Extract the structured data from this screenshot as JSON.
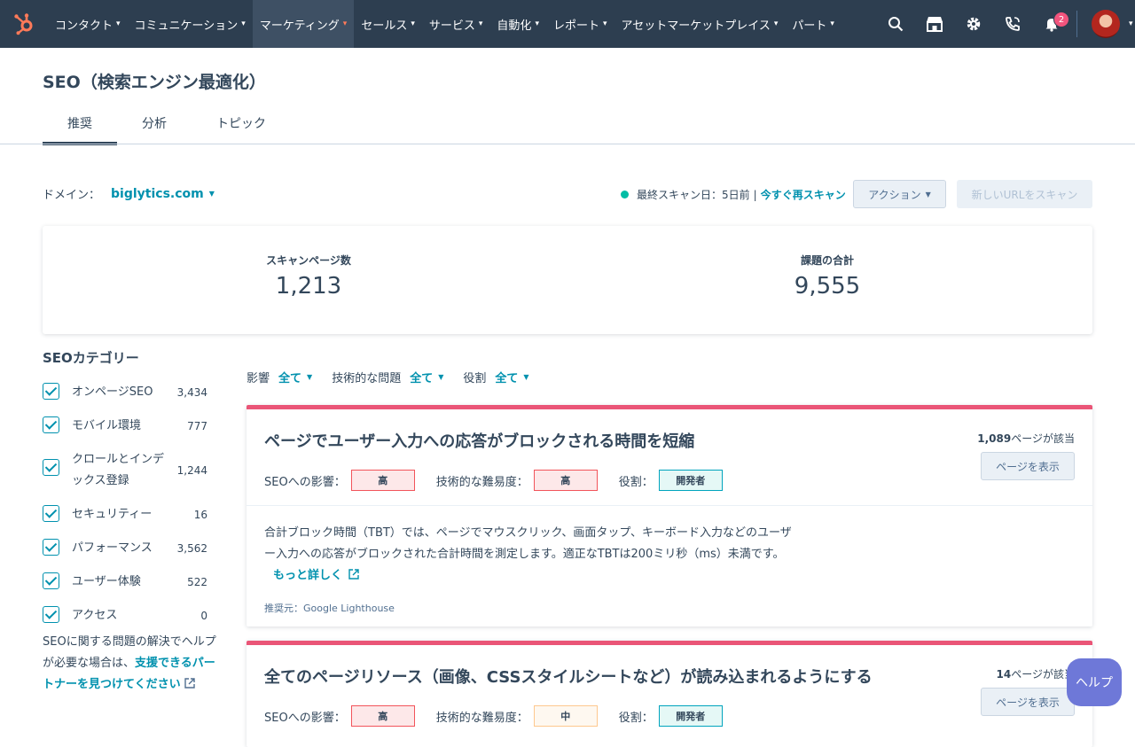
{
  "nav": {
    "items": [
      {
        "label": "コンタクト",
        "active": false
      },
      {
        "label": "コミュニケーション",
        "active": false
      },
      {
        "label": "マーケティング",
        "active": true
      },
      {
        "label": "セールス",
        "active": false
      },
      {
        "label": "サービス",
        "active": false
      },
      {
        "label": "自動化",
        "active": false
      },
      {
        "label": "レポート",
        "active": false
      },
      {
        "label": "アセットマーケットプレイス",
        "active": false
      },
      {
        "label": "パート",
        "active": false
      }
    ],
    "notification_count": "2",
    "accent_color": "#ff7a59"
  },
  "page": {
    "title": "SEO（検索エンジン最適化）",
    "tabs": [
      "推奨",
      "分析",
      "トピック"
    ]
  },
  "domain": {
    "label": "ドメイン：",
    "value": "biglytics.com"
  },
  "scan": {
    "status_text": "最終スキャン日：5日前",
    "separator": "|",
    "rescan_label": "今すぐ再スキャン",
    "action_label": "アクション",
    "new_url_label": "新しいURLをスキャン"
  },
  "stats": {
    "pages_label": "スキャンページ数",
    "pages_value": "1,213",
    "issues_label": "課題の合計",
    "issues_value": "9,555"
  },
  "sidebar": {
    "title": "SEOカテゴリー",
    "categories": [
      {
        "label": "オンページSEO",
        "count": "3,434",
        "checked": true
      },
      {
        "label": "モバイル環境",
        "count": "777",
        "checked": true
      },
      {
        "label": "クロールとインデックス登録",
        "count": "1,244",
        "checked": true
      },
      {
        "label": "セキュリティー",
        "count": "16",
        "checked": true
      },
      {
        "label": "パフォーマンス",
        "count": "3,562",
        "checked": true
      },
      {
        "label": "ユーザー体験",
        "count": "522",
        "checked": true
      },
      {
        "label": "アクセス",
        "count": "0",
        "checked": true
      }
    ],
    "help_prefix": "SEOに関する問題の解決でヘルプが必要な場合は、",
    "help_link": "支援できるパートナーを見つけてください"
  },
  "filters": [
    {
      "label": "影響",
      "value": "全て"
    },
    {
      "label": "技術的な問題",
      "value": "全て"
    },
    {
      "label": "役割",
      "value": "全て"
    }
  ],
  "cards": [
    {
      "title": "ページでユーザー入力への応答がブロックされる時間を短縮",
      "pages_count": "1,089",
      "pages_suffix": "ページが該当",
      "view_label": "ページを表示",
      "impact_label": "SEOへの影響：",
      "impact_value": "高",
      "difficulty_label": "技術的な難易度：",
      "difficulty_value": "高",
      "role_label": "役割：",
      "role_value": "開発者",
      "description": "合計ブロック時間（TBT）では、ページでマウスクリック、画面タップ、キーボード入力などのユーザー入力への応答がブロックされた合計時間を測定します。適正なTBTは200ミリ秒（ms）未満です。",
      "more_label": "もっと詳しく",
      "source": "推奨元：Google Lighthouse"
    },
    {
      "title": "全てのページリソース（画像、CSSスタイルシートなど）が読み込まれるようにする",
      "pages_count": "14",
      "pages_suffix": "ページが該当",
      "view_label": "ページを表示",
      "impact_label": "SEOへの影響：",
      "impact_value": "高",
      "difficulty_label": "技術的な難易度：",
      "difficulty_value": "中",
      "role_label": "役割：",
      "role_value": "開発者"
    }
  ],
  "help_button": "ヘルプ"
}
